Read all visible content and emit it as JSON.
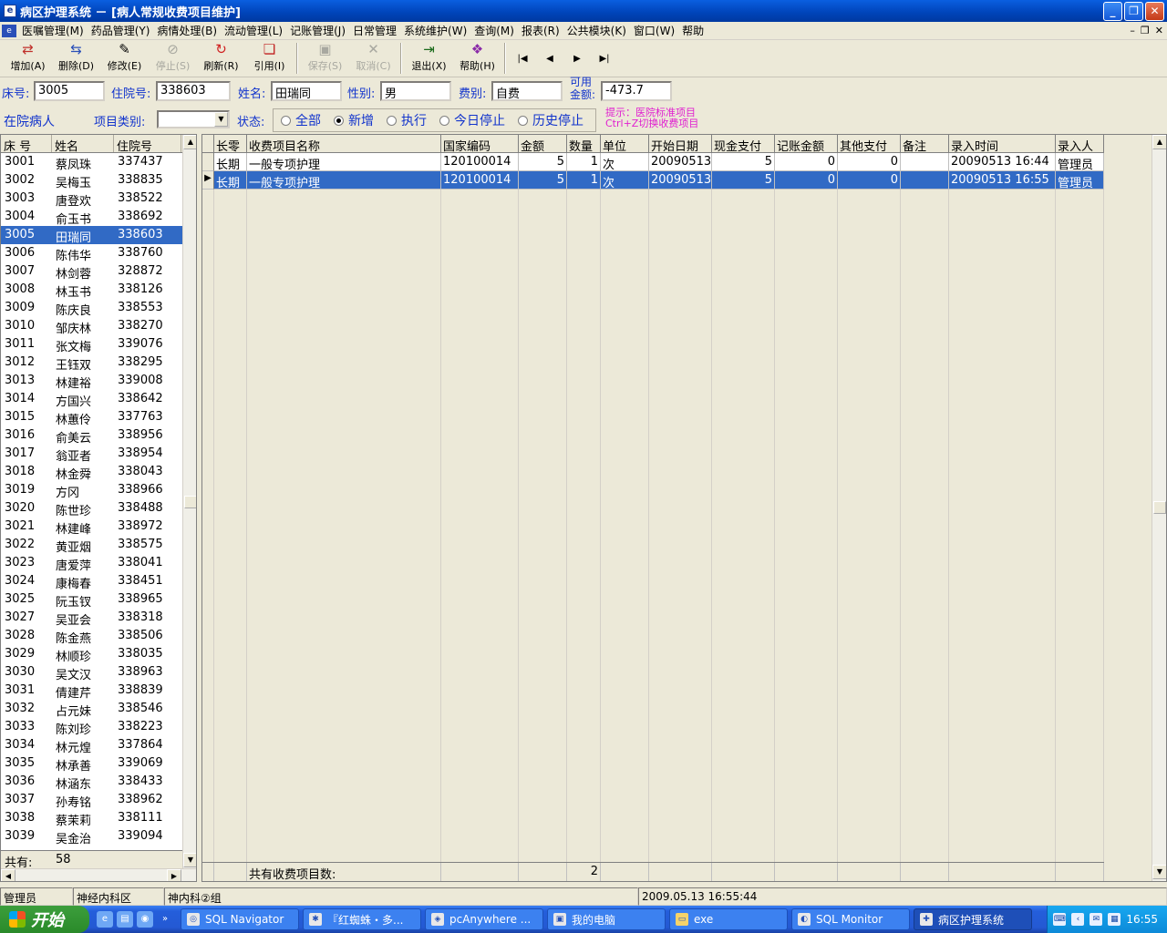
{
  "window": {
    "title": "病区护理系统 － [病人常规收费项目维护]"
  },
  "menu": [
    "医嘱管理(M)",
    "药品管理(Y)",
    "病情处理(B)",
    "流动管理(L)",
    "记账管理(J)",
    "日常管理",
    "系统维护(W)",
    "查询(M)",
    "报表(R)",
    "公共模块(K)",
    "窗口(W)",
    "帮助"
  ],
  "toolbar": {
    "buttons": [
      {
        "label": "增加(A)",
        "icon": "add-icon",
        "enabled": true
      },
      {
        "label": "删除(D)",
        "icon": "delete-icon",
        "enabled": true
      },
      {
        "label": "修改(E)",
        "icon": "edit-icon",
        "enabled": true
      },
      {
        "label": "停止(S)",
        "icon": "stop-icon",
        "enabled": false
      },
      {
        "label": "刷新(R)",
        "icon": "refresh-icon",
        "enabled": true
      },
      {
        "label": "引用(I)",
        "icon": "reference-icon",
        "enabled": true
      },
      {
        "label": "保存(S)",
        "icon": "save-icon",
        "enabled": false
      },
      {
        "label": "取消(C)",
        "icon": "cancel-icon",
        "enabled": false
      },
      {
        "label": "退出(X)",
        "icon": "exit-icon",
        "enabled": true
      },
      {
        "label": "帮助(H)",
        "icon": "help-icon",
        "enabled": true
      }
    ]
  },
  "patient_info": {
    "bed_label": "床号:",
    "bed_value": "3005",
    "admission_label": "住院号:",
    "admission_value": "338603",
    "name_label": "姓名:",
    "name_value": "田瑞同",
    "gender_label": "性别:",
    "gender_value": "男",
    "fee_type_label": "费别:",
    "fee_type_value": "自费",
    "balance_label_1": "可用",
    "balance_label_2": "金额:",
    "balance_value": "-473.7"
  },
  "filter": {
    "inpatient_label": "在院病人",
    "category_label": "项目类别:",
    "category_value": "",
    "status_label": "状态:",
    "status_options": [
      {
        "label": "全部",
        "checked": false
      },
      {
        "label": "新增",
        "checked": true
      },
      {
        "label": "执行",
        "checked": false
      },
      {
        "label": "今日停止",
        "checked": false
      },
      {
        "label": "历史停止",
        "checked": false
      }
    ],
    "hint_line1": "提示：医院标准项目",
    "hint_line2": "Ctrl+Z切换收费项目"
  },
  "patients": {
    "headers": [
      "床 号",
      "姓名",
      "住院号"
    ],
    "rows": [
      [
        "3001",
        "蔡凤珠",
        "337437"
      ],
      [
        "3002",
        "吴梅玉",
        "338835"
      ],
      [
        "3003",
        "唐登欢",
        "338522"
      ],
      [
        "3004",
        "俞玉书",
        "338692"
      ],
      [
        "3005",
        "田瑞同",
        "338603"
      ],
      [
        "3006",
        "陈伟华",
        "338760"
      ],
      [
        "3007",
        "林剑蓉",
        "328872"
      ],
      [
        "3008",
        "林玉书",
        "338126"
      ],
      [
        "3009",
        "陈庆良",
        "338553"
      ],
      [
        "3010",
        "邹庆林",
        "338270"
      ],
      [
        "3011",
        "张文梅",
        "339076"
      ],
      [
        "3012",
        "王钰双",
        "338295"
      ],
      [
        "3013",
        "林建裕",
        "339008"
      ],
      [
        "3014",
        "方国兴",
        "338642"
      ],
      [
        "3015",
        "林蕙伶",
        "337763"
      ],
      [
        "3016",
        "俞美云",
        "338956"
      ],
      [
        "3017",
        "翁亚者",
        "338954"
      ],
      [
        "3018",
        "林金舜",
        "338043"
      ],
      [
        "3019",
        "方冈",
        "338966"
      ],
      [
        "3020",
        "陈世珍",
        "338488"
      ],
      [
        "3021",
        "林建峰",
        "338972"
      ],
      [
        "3022",
        "黄亚烟",
        "338575"
      ],
      [
        "3023",
        "唐爱萍",
        "338041"
      ],
      [
        "3024",
        "康梅春",
        "338451"
      ],
      [
        "3025",
        "阮玉钗",
        "338965"
      ],
      [
        "3027",
        "吴亚会",
        "338318"
      ],
      [
        "3028",
        "陈金燕",
        "338506"
      ],
      [
        "3029",
        "林顺珍",
        "338035"
      ],
      [
        "3030",
        "吴文汉",
        "338963"
      ],
      [
        "3031",
        "倩建芹",
        "338839"
      ],
      [
        "3032",
        "占元妹",
        "338546"
      ],
      [
        "3033",
        "陈刘珍",
        "338223"
      ],
      [
        "3034",
        "林元煌",
        "337864"
      ],
      [
        "3035",
        "林承善",
        "339069"
      ],
      [
        "3036",
        "林涵东",
        "338433"
      ],
      [
        "3037",
        "孙寿铭",
        "338962"
      ],
      [
        "3038",
        "蔡茉莉",
        "338111"
      ],
      [
        "3039",
        "吴金治",
        "339094"
      ]
    ],
    "selected_index": 4,
    "total_label": "共有:",
    "total_value": "58"
  },
  "charges": {
    "headers": [
      "长零",
      "收费项目名称",
      "国家编码",
      "金额",
      "数量",
      "单位",
      "开始日期",
      "现金支付",
      "记账金额",
      "其他支付",
      "备注",
      "录入时间",
      "录入人"
    ],
    "rows": [
      [
        "长期",
        "一般专项护理",
        "120100014",
        "5",
        "1",
        "次",
        "20090513",
        "5",
        "0",
        "0",
        "",
        "20090513 16:44",
        "管理员"
      ],
      [
        "长期",
        "一般专项护理",
        "120100014",
        "5",
        "1",
        "次",
        "20090513",
        "5",
        "0",
        "0",
        "",
        "20090513 16:55",
        "管理员"
      ]
    ],
    "selected_index": 1,
    "footer_label": "共有收费项目数:",
    "footer_count": "2"
  },
  "statusbar": [
    "管理员",
    "神经内科区",
    "神内科②组",
    "",
    "2009.05.13 16:55:44"
  ],
  "taskbar": {
    "start_label": "开始",
    "tasks": [
      {
        "label": "SQL Navigator",
        "active": false
      },
      {
        "label": "『红蜘蛛・多...",
        "active": false
      },
      {
        "label": "pcAnywhere ...",
        "active": false
      },
      {
        "label": "我的电脑",
        "active": false
      },
      {
        "label": "exe",
        "active": false
      },
      {
        "label": "SQL Monitor",
        "active": false
      },
      {
        "label": "病区护理系统",
        "active": true
      }
    ],
    "clock": "16:55"
  }
}
